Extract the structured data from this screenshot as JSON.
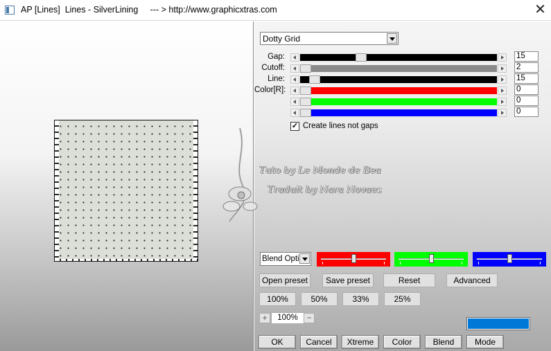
{
  "window": {
    "title": "AP [Lines]  Lines - SilverLining     --- > http://www.graphicxtras.com",
    "close_glyph": "✕"
  },
  "preset": {
    "selected": "Dotty Grid"
  },
  "sliders": [
    {
      "label": "Gap:",
      "value": "15",
      "track_color": "#000000",
      "fill_fraction": 0.3
    },
    {
      "label": "Cutoff:",
      "value": "2",
      "track_color": "#8a8a8a",
      "fill_fraction": 0.0
    },
    {
      "label": "Line:",
      "value": "15",
      "track_color": "#000000",
      "fill_fraction": 0.05
    },
    {
      "label": "Color[R]:",
      "value": "0",
      "track_color": "#ff0000",
      "fill_fraction": 0.0
    },
    {
      "label": "",
      "value": "0",
      "track_color": "#00ff00",
      "fill_fraction": 0.0
    },
    {
      "label": "",
      "value": "0",
      "track_color": "#0000ff",
      "fill_fraction": 0.0
    }
  ],
  "checkbox": {
    "label": "Create lines not gaps",
    "checked": true,
    "mark": "✓"
  },
  "watermark": {
    "line1": "Tuto by Le Monde de Bea",
    "line2": "Traduit by Nara Novaes"
  },
  "blend": {
    "selected": "Blend Optio",
    "red_color": "#ff0000",
    "green_color": "#00ff00",
    "blue_color": "#0000ff",
    "red_level": 0.5,
    "green_level": 0.5,
    "blue_level": 0.5
  },
  "buttons": {
    "open_preset": "Open preset",
    "save_preset": "Save preset",
    "reset": "Reset",
    "advanced": "Advanced",
    "zoom_100": "100%",
    "zoom_50": "50%",
    "zoom_33": "33%",
    "zoom_25": "25%",
    "ok": "OK",
    "cancel": "Cancel",
    "xtreme": "Xtreme",
    "color": "Color",
    "blend": "Blend",
    "mode": "Mode"
  },
  "zoom": {
    "value": "100%",
    "plus": "+",
    "minus": "−"
  },
  "accent_color": "#0078d7"
}
